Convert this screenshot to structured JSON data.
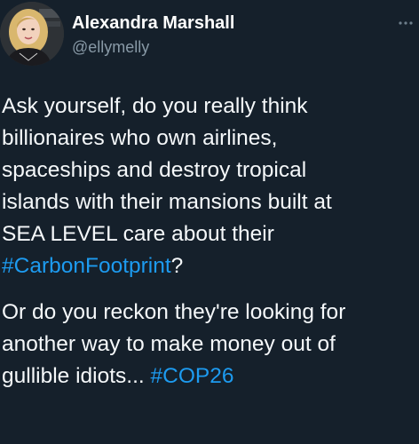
{
  "author": {
    "name": "Alexandra Marshall",
    "handle": "@ellymelly"
  },
  "icons": {
    "avatar": "profile-photo",
    "more": "more-options-icon"
  },
  "colors": {
    "background": "#15202b",
    "text": "#f5f8fa",
    "handle": "#8899a6",
    "hashtag": "#1d9bf0"
  },
  "tweet": {
    "paragraph1": {
      "lines": [
        "Ask yourself, do you really think",
        "billionaires who own airlines,",
        "spaceships and destroy tropical",
        "islands with their mansions built at",
        "SEA LEVEL care about their"
      ],
      "hashtag": "#CarbonFootprint",
      "hashtag_suffix": "?"
    },
    "paragraph2": {
      "lines": [
        "Or do you reckon they're looking for",
        "another way to make money out of"
      ],
      "last_line_text": "gullible idiots... ",
      "hashtag": "#COP26"
    }
  }
}
